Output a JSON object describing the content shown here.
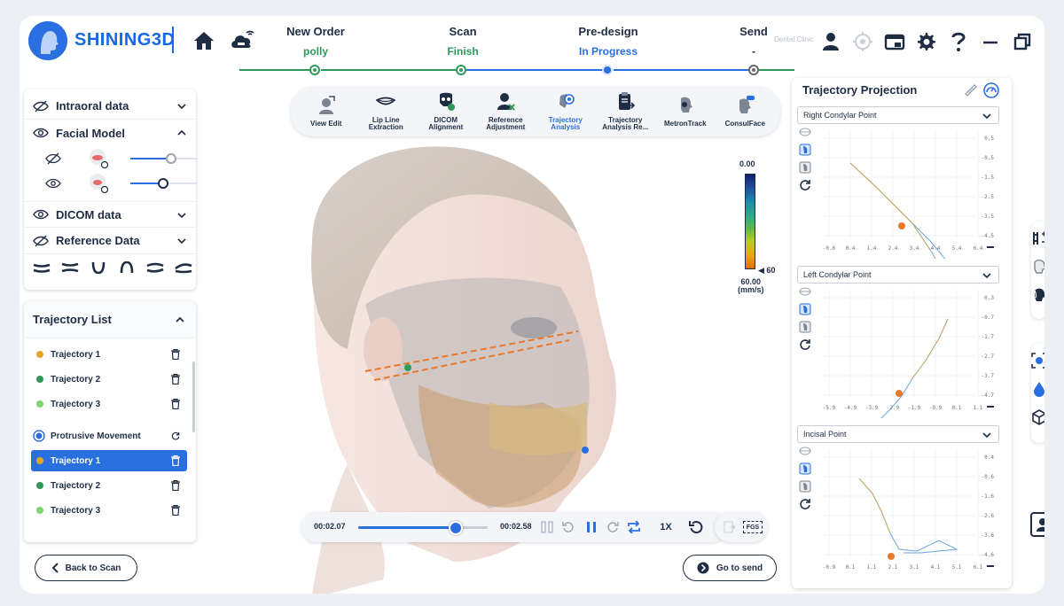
{
  "brand": {
    "name": "SHINING3D",
    "colors": {
      "primary": "#2a6fe0",
      "done": "#2e9a5a",
      "text": "#1f2d44"
    }
  },
  "steps": [
    {
      "title": "New Order",
      "status": "polly",
      "color": "#2e9a5a"
    },
    {
      "title": "Scan",
      "status": "Finish",
      "color": "#2e9a5a"
    },
    {
      "title": "Pre-design",
      "status": "In Progress",
      "color": "#2a6fe0"
    },
    {
      "title": "Send",
      "status": "-",
      "color": "#1f2d44"
    }
  ],
  "header": {
    "clinic": "Dental Clinic",
    "icons": [
      "user-icon",
      "target-icon",
      "screenshot-icon",
      "gear-icon",
      "help-icon",
      "minimize-icon",
      "restore-icon",
      "close-icon"
    ]
  },
  "left_panel": {
    "rows": [
      {
        "label": "Intraoral data",
        "visible": false,
        "expanded": false
      },
      {
        "label": "Facial Model",
        "visible": true,
        "expanded": true
      },
      {
        "label": "DICOM data",
        "visible": true,
        "expanded": false
      },
      {
        "label": "Reference Data",
        "visible": false,
        "expanded": false
      }
    ],
    "facial_sliders": [
      0.6,
      0.5
    ]
  },
  "trajectory_list": {
    "title": "Trajectory List",
    "group1": [
      {
        "label": "Trajectory 1",
        "color": "#e8a522"
      },
      {
        "label": "Trajectory 2",
        "color": "#2e9a5a"
      },
      {
        "label": "Trajectory 3",
        "color": "#7fd36b"
      }
    ],
    "group2_title": "Protrusive Movement",
    "group2": [
      {
        "label": "Trajectory 1",
        "color": "#e8a522",
        "selected": true
      },
      {
        "label": "Trajectory 2",
        "color": "#2e9a5a",
        "selected": false
      },
      {
        "label": "Trajectory 3",
        "color": "#7fd36b",
        "selected": false
      }
    ]
  },
  "buttons": {
    "back": "Back to Scan",
    "next": "Go to send"
  },
  "toolbar": [
    {
      "label": "View Edit",
      "icon": "view-edit-icon"
    },
    {
      "label": "Lip Line\nExtraction",
      "icon": "lip-icon"
    },
    {
      "label": "DICOM\nAlignment",
      "icon": "dicom-icon"
    },
    {
      "label": "Reference\nAdjustment",
      "icon": "reference-icon"
    },
    {
      "label": "Trajectory\nAnalysis",
      "icon": "trajectory-icon",
      "active": true
    },
    {
      "label": "Trajectory\nAnalysis Re...",
      "icon": "report-icon"
    },
    {
      "label": "MetronTrack",
      "icon": "metron-icon"
    },
    {
      "label": "ConsulFace",
      "icon": "consulface-icon"
    }
  ],
  "colorbar": {
    "top": "0.00",
    "marker": "60",
    "bottom_value": "60.00",
    "unit": "(mm/s)"
  },
  "player": {
    "current": "00:02.07",
    "total": "00:02.58",
    "progress": 0.75,
    "speed": "1X",
    "export": "FGS"
  },
  "projection": {
    "title": "Trajectory Projection",
    "panels": [
      {
        "label": "Right Condylar Point",
        "xticks": [
          "-0.6",
          "0.4",
          "1.4",
          "2.4",
          "3.4",
          "4.4",
          "5.4",
          "6.4"
        ],
        "yticks": [
          "0.5",
          "-0.5",
          "-1.5",
          "-2.5",
          "-3.5",
          "-4.5"
        ]
      },
      {
        "label": "Left Condylar Point",
        "xticks": [
          "-5.9",
          "-4.9",
          "-3.9",
          "-2.9",
          "-1.9",
          "-0.9",
          "0.1",
          "1.1"
        ],
        "yticks": [
          "0.3",
          "-0.7",
          "-1.7",
          "-2.7",
          "-3.7",
          "-4.7"
        ]
      },
      {
        "label": "Incisal Point",
        "xticks": [
          "-0.9",
          "0.1",
          "1.1",
          "2.1",
          "3.1",
          "4.1",
          "5.1",
          "6.1"
        ],
        "yticks": [
          "0.4",
          "-0.6",
          "-1.6",
          "-2.6",
          "-3.6",
          "-4.6"
        ]
      }
    ]
  }
}
